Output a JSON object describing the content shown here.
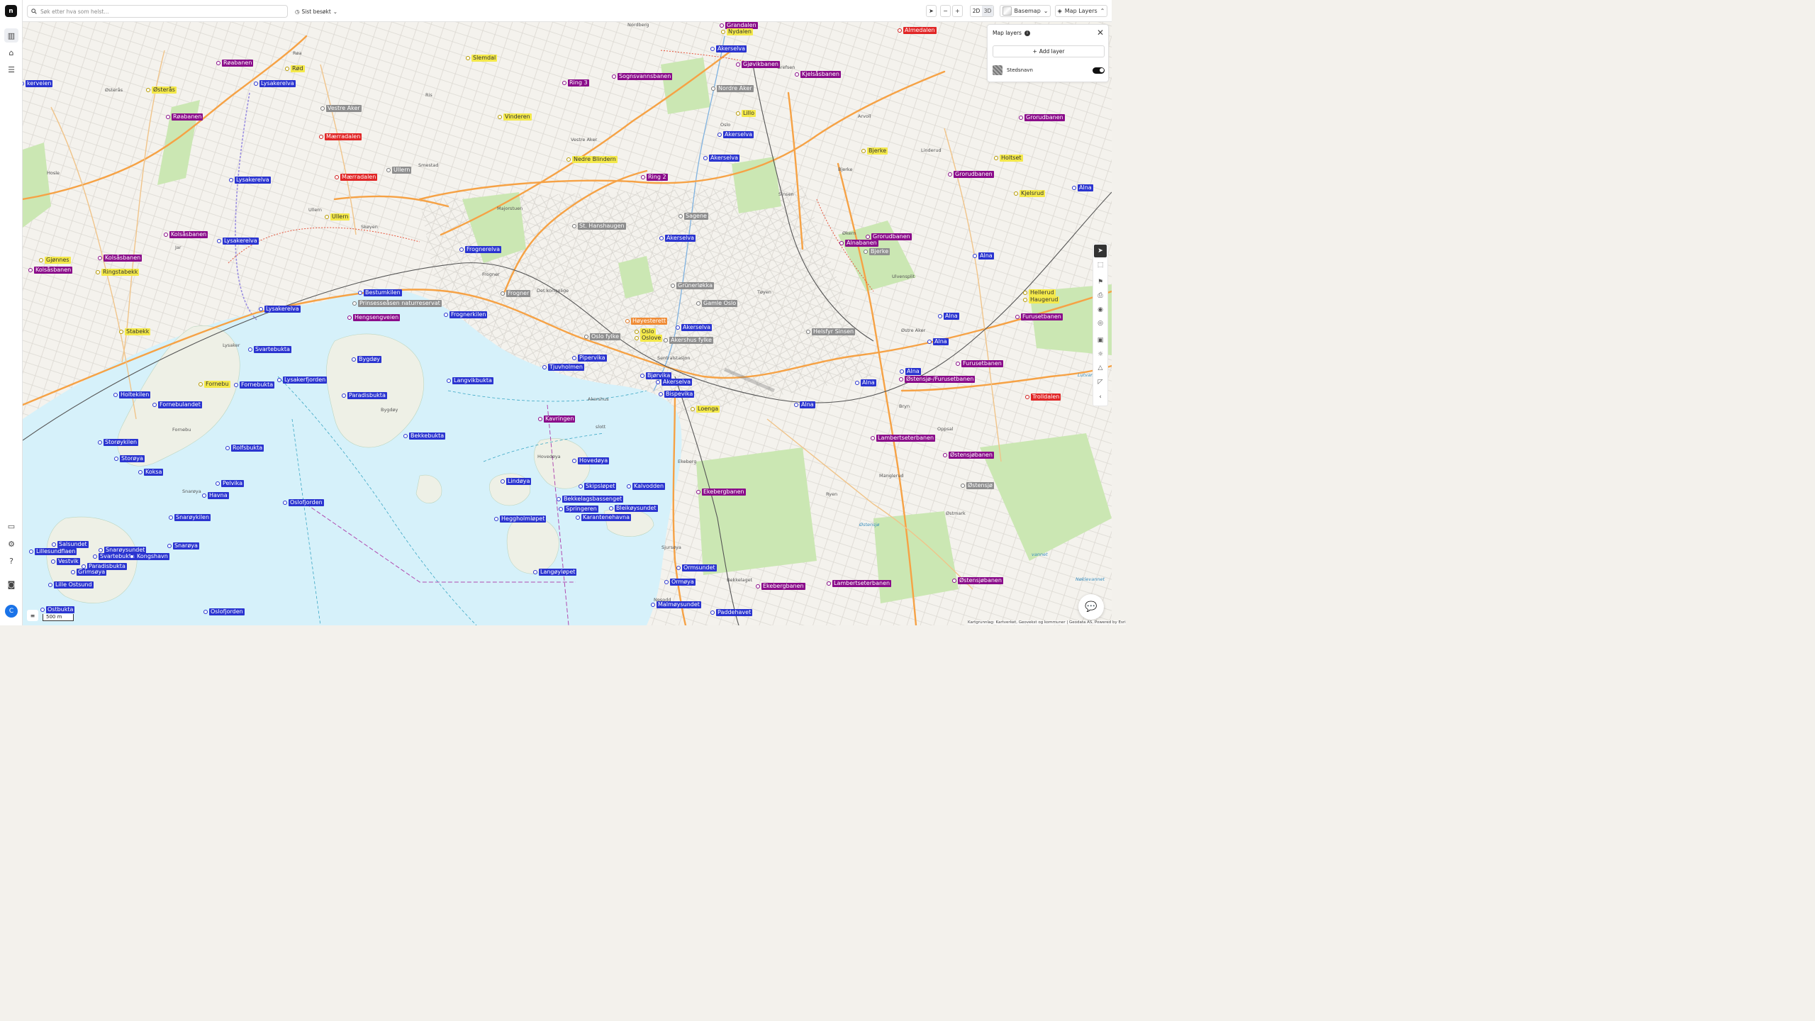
{
  "rail": {
    "logo": "n",
    "items": [
      "map-icon",
      "tag-icon",
      "list-icon"
    ],
    "bottom": [
      "chat-icon",
      "gear-icon",
      "help-icon",
      "record-icon"
    ],
    "avatar_initial": "C"
  },
  "topbar": {
    "search_placeholder": "Søk etter hva som helst...",
    "recent_label": "Sist besøkt",
    "view_2d": "2D",
    "view_3d": "3D",
    "basemap_label": "Basemap",
    "map_layers_label": "Map Layers"
  },
  "panel": {
    "title": "Map layers",
    "add_layer_label": "Add layer",
    "layers": [
      {
        "name": "Stedsnavn",
        "enabled": true
      }
    ]
  },
  "scale": "500 m",
  "attribution": "Kartgrunnlag: Kartverket, Geovekst og kommuner | Geodata AS, Powered by Esri",
  "colors": {
    "blue": "#2a34d0",
    "purple": "#8a0c8a",
    "yellow": "#f4e94a",
    "gray": "#8e8e8e",
    "red": "#e12626",
    "orange": "#f08c36",
    "water": "#d6f1fa",
    "park": "#c8e6b0",
    "road_major": "#f6a245"
  },
  "places": [
    {
      "name": "Grandalen",
      "c": "purple"
    },
    {
      "name": "Nydalen",
      "c": "yellow"
    },
    {
      "name": "Akerselva",
      "c": "blue"
    },
    {
      "name": "Almedalen",
      "c": "red"
    },
    {
      "name": "Gjøvikbanen",
      "c": "purple"
    },
    {
      "name": "Kjelsåsbanen",
      "c": "purple"
    },
    {
      "name": "Nordre Aker",
      "c": "gray"
    },
    {
      "name": "Lillo",
      "c": "yellow"
    },
    {
      "name": "Akerselva",
      "c": "blue"
    },
    {
      "name": "Akerselva",
      "c": "blue"
    },
    {
      "name": "Grorudbanen",
      "c": "purple"
    },
    {
      "name": "Bjerke",
      "c": "yellow"
    },
    {
      "name": "Holtset",
      "c": "yellow"
    },
    {
      "name": "Grorudbanen",
      "c": "purple"
    },
    {
      "name": "Alna",
      "c": "blue"
    },
    {
      "name": "Kjelsrud",
      "c": "yellow"
    },
    {
      "name": "Grorudbanen",
      "c": "purple"
    },
    {
      "name": "Alnabanen",
      "c": "purple"
    },
    {
      "name": "Bjerke",
      "c": "gray"
    },
    {
      "name": "Alna",
      "c": "blue"
    },
    {
      "name": "Hellerud",
      "c": "yellow"
    },
    {
      "name": "Haugerud",
      "c": "yellow"
    },
    {
      "name": "Furusetbanen",
      "c": "purple"
    },
    {
      "name": "Alna",
      "c": "blue"
    },
    {
      "name": "Alna",
      "c": "blue"
    },
    {
      "name": "Furusetbanen",
      "c": "purple"
    },
    {
      "name": "Alna",
      "c": "blue"
    },
    {
      "name": "Østensjø-/Furusetbanen",
      "c": "purple"
    },
    {
      "name": "Alna",
      "c": "blue"
    },
    {
      "name": "Alna",
      "c": "blue"
    },
    {
      "name": "Trolldalen",
      "c": "red"
    },
    {
      "name": "Lambertseterbanen",
      "c": "purple"
    },
    {
      "name": "Østensjøbanen",
      "c": "purple"
    },
    {
      "name": "Østensjø",
      "c": "gray"
    },
    {
      "name": "Østensjøbanen",
      "c": "purple"
    },
    {
      "name": "Lambertseterbanen",
      "c": "purple"
    },
    {
      "name": "Ekebergbanen",
      "c": "purple"
    },
    {
      "name": "Helsfyr Sinsen",
      "c": "gray"
    },
    {
      "name": "Slemdal",
      "c": "yellow"
    },
    {
      "name": "Ring 3",
      "c": "purple"
    },
    {
      "name": "Sognsvannsbanen",
      "c": "purple"
    },
    {
      "name": "Vinderen",
      "c": "yellow"
    },
    {
      "name": "Nedre Blindern",
      "c": "yellow"
    },
    {
      "name": "Ring 2",
      "c": "purple"
    },
    {
      "name": "Sagene",
      "c": "gray"
    },
    {
      "name": "St. Hanshaugen",
      "c": "gray"
    },
    {
      "name": "Akerselva",
      "c": "blue"
    },
    {
      "name": "Grünerløkka",
      "c": "gray"
    },
    {
      "name": "Gamle Oslo",
      "c": "gray"
    },
    {
      "name": "Akerselva",
      "c": "blue"
    },
    {
      "name": "Akershus fylke",
      "c": "gray"
    },
    {
      "name": "Høyesterett",
      "c": "orange"
    },
    {
      "name": "Oslo",
      "c": "yellow"
    },
    {
      "name": "Oslove",
      "c": "yellow"
    },
    {
      "name": "Oslo fylke",
      "c": "gray"
    },
    {
      "name": "Bjørvika",
      "c": "blue"
    },
    {
      "name": "Akerselva",
      "c": "blue"
    },
    {
      "name": "Bispevika",
      "c": "blue"
    },
    {
      "name": "Loenga",
      "c": "yellow"
    },
    {
      "name": "Frognerelva",
      "c": "blue"
    },
    {
      "name": "Frogner",
      "c": "gray"
    },
    {
      "name": "Frognerkilen",
      "c": "blue"
    },
    {
      "name": "Pipervika",
      "c": "blue"
    },
    {
      "name": "Tjuvholmen",
      "c": "blue"
    },
    {
      "name": "Langvikbukta",
      "c": "blue"
    },
    {
      "name": "Kavringen",
      "c": "purple"
    },
    {
      "name": "Hovedøya",
      "c": "blue"
    },
    {
      "name": "Lindøya",
      "c": "blue"
    },
    {
      "name": "Skipsløpet",
      "c": "blue"
    },
    {
      "name": "Kalvodden",
      "c": "blue"
    },
    {
      "name": "Bekkelagsbassenget",
      "c": "blue"
    },
    {
      "name": "Springeren",
      "c": "blue"
    },
    {
      "name": "Bleikøysundet",
      "c": "blue"
    },
    {
      "name": "Karantenehavna",
      "c": "blue"
    },
    {
      "name": "Heggholmløpet",
      "c": "blue"
    },
    {
      "name": "Langøyløpet",
      "c": "blue"
    },
    {
      "name": "Ormsundet",
      "c": "blue"
    },
    {
      "name": "Ormøya",
      "c": "blue"
    },
    {
      "name": "Ekebergbanen",
      "c": "purple"
    },
    {
      "name": "Malmøysundet",
      "c": "blue"
    },
    {
      "name": "Paddehavet",
      "c": "blue"
    },
    {
      "name": "Vestre Aker",
      "c": "gray"
    },
    {
      "name": "Mærradalen",
      "c": "red"
    },
    {
      "name": "Mærradalen",
      "c": "red"
    },
    {
      "name": "Ullern",
      "c": "gray"
    },
    {
      "name": "Ullern",
      "c": "yellow"
    },
    {
      "name": "Bestumkilen",
      "c": "blue"
    },
    {
      "name": "Prinsesseåsen naturreservat",
      "c": "gray"
    },
    {
      "name": "Hengsengveien",
      "c": "purple"
    },
    {
      "name": "Bygdøy",
      "c": "blue"
    },
    {
      "name": "Paradisbukta",
      "c": "blue"
    },
    {
      "name": "Bekkebukta",
      "c": "blue"
    },
    {
      "name": "Røabanen",
      "c": "purple"
    },
    {
      "name": "Rød",
      "c": "yellow"
    },
    {
      "name": "Lysakerelva",
      "c": "blue"
    },
    {
      "name": "Østerås",
      "c": "yellow"
    },
    {
      "name": "Røabanen",
      "c": "purple"
    },
    {
      "name": "Lysakerelva",
      "c": "blue"
    },
    {
      "name": "Kolsåsbanen",
      "c": "purple"
    },
    {
      "name": "Lysakerelva",
      "c": "blue"
    },
    {
      "name": "Kolsåsbanen",
      "c": "purple"
    },
    {
      "name": "Gjønnes",
      "c": "yellow"
    },
    {
      "name": "Kolsåsbanen",
      "c": "purple"
    },
    {
      "name": "Ringstabekk",
      "c": "yellow"
    },
    {
      "name": "Lysakerelva",
      "c": "blue"
    },
    {
      "name": "Stabekk",
      "c": "yellow"
    },
    {
      "name": "Svartebukta",
      "c": "blue"
    },
    {
      "name": "Lysakerfjorden",
      "c": "blue"
    },
    {
      "name": "Fornebu",
      "c": "yellow"
    },
    {
      "name": "Fornebukta",
      "c": "blue"
    },
    {
      "name": "Holtekilen",
      "c": "blue"
    },
    {
      "name": "Fornebulandet",
      "c": "blue"
    },
    {
      "name": "Storøykilen",
      "c": "blue"
    },
    {
      "name": "Rolfsbukta",
      "c": "blue"
    },
    {
      "name": "Storøya",
      "c": "blue"
    },
    {
      "name": "Koksa",
      "c": "blue"
    },
    {
      "name": "Pelvika",
      "c": "blue"
    },
    {
      "name": "Havna",
      "c": "blue"
    },
    {
      "name": "Oslofjorden",
      "c": "blue"
    },
    {
      "name": "Snarøykilen",
      "c": "blue"
    },
    {
      "name": "Salsundet",
      "c": "blue"
    },
    {
      "name": "Lillesundflaen",
      "c": "blue"
    },
    {
      "name": "Snarøysundet",
      "c": "blue"
    },
    {
      "name": "Svartebukta",
      "c": "blue"
    },
    {
      "name": "Kongshavn",
      "c": "blue"
    },
    {
      "name": "Snarøya",
      "c": "blue"
    },
    {
      "name": "Vestvik",
      "c": "blue"
    },
    {
      "name": "Paradisbukta",
      "c": "blue"
    },
    {
      "name": "Grimsøya",
      "c": "blue"
    },
    {
      "name": "Lille Ostsund",
      "c": "blue"
    },
    {
      "name": "Ostbukta",
      "c": "blue"
    },
    {
      "name": "Oslofjorden",
      "c": "blue"
    },
    {
      "name": "kerveien",
      "c": "blue"
    }
  ],
  "base_labels": [
    "Nordberg",
    "Grefsen",
    "Oslo",
    "Arvoll",
    "Linderud",
    "Bjerke",
    "Sinsen",
    "Økern",
    "Tøyen",
    "Ulvensplit",
    "Østre Aker",
    "Bryn",
    "Oppsal",
    "Manglerud",
    "Ryen",
    "Østmark",
    "Ekeberg",
    "Sjursøya",
    "Bekkelaget",
    "Nesodd",
    "Akershus",
    "slott",
    "Hovedøya",
    "Det kongelige",
    "Frogner",
    "Majorstuen",
    "Skøyen",
    "Smestad",
    "Ullern",
    "Ris",
    "Vestre Aker",
    "Røa",
    "Jar",
    "Lysaker",
    "Fornebu",
    "Snarøya",
    "Bygdøy",
    "Hosle",
    "Østerås",
    "Sentralstasjon",
    "Lutvann",
    "vannet",
    "Nøklevannet",
    "Østensjø"
  ]
}
